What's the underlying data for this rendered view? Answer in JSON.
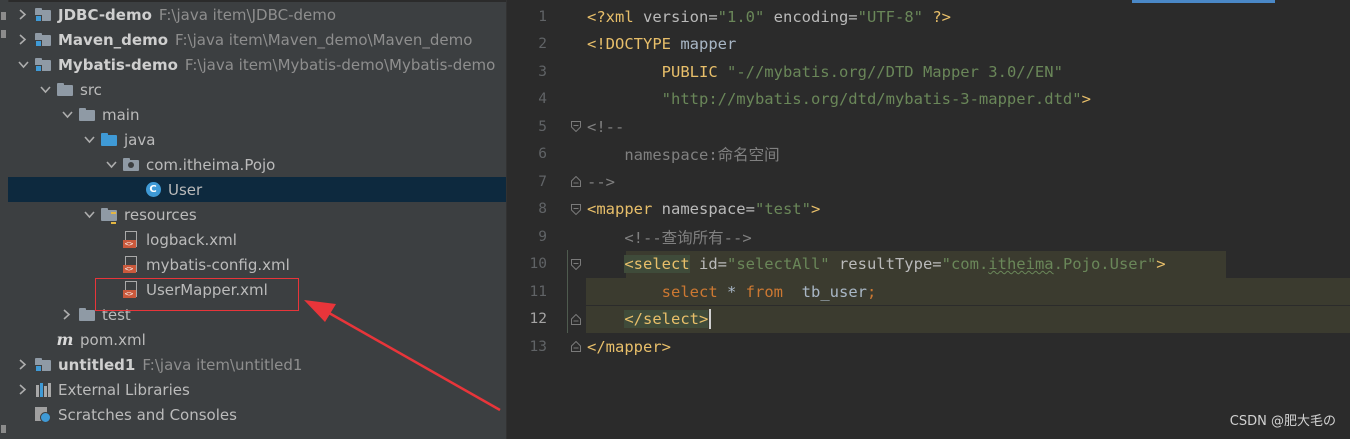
{
  "tree": {
    "items": [
      {
        "label": "JDBC-demo",
        "path": "F:\\java item\\JDBC-demo",
        "icon": "module-folder-icon",
        "arrow": "right",
        "depth": 0,
        "bold": true
      },
      {
        "label": "Maven_demo",
        "path": "F:\\java item\\Maven_demo\\Maven_demo",
        "icon": "module-folder-icon",
        "arrow": "right",
        "depth": 0,
        "bold": true
      },
      {
        "label": "Mybatis-demo",
        "path": "F:\\java item\\Mybatis-demo\\Mybatis-demo",
        "icon": "module-folder-icon",
        "arrow": "down",
        "depth": 0,
        "bold": true
      },
      {
        "label": "src",
        "icon": "folder-icon",
        "arrow": "down",
        "depth": 1
      },
      {
        "label": "main",
        "icon": "folder-icon",
        "arrow": "down",
        "depth": 2
      },
      {
        "label": "java",
        "icon": "source-folder-icon",
        "arrow": "down",
        "depth": 3
      },
      {
        "label": "com.itheima.Pojo",
        "icon": "package-icon",
        "arrow": "down",
        "depth": 4
      },
      {
        "label": "User",
        "icon": "java-class-icon",
        "arrow": "none",
        "depth": 5,
        "selected": true
      },
      {
        "label": "resources",
        "icon": "resources-folder-icon",
        "arrow": "down",
        "depth": 3
      },
      {
        "label": "logback.xml",
        "icon": "xml-file-icon",
        "arrow": "none",
        "depth": 4
      },
      {
        "label": "mybatis-config.xml",
        "icon": "xml-file-icon",
        "arrow": "none",
        "depth": 4
      },
      {
        "label": "UserMapper.xml",
        "icon": "xml-file-icon",
        "arrow": "none",
        "depth": 4
      },
      {
        "label": "test",
        "icon": "folder-icon",
        "arrow": "right",
        "depth": 2
      },
      {
        "label": "pom.xml",
        "icon": "maven-icon",
        "arrow": "none",
        "depth": 1
      },
      {
        "label": "untitled1",
        "path": "F:\\java item\\untitled1",
        "icon": "module-folder-icon",
        "arrow": "right",
        "depth": 0,
        "bold": true
      },
      {
        "label": "External Libraries",
        "icon": "libraries-icon",
        "arrow": "right",
        "depth": 0
      },
      {
        "label": "Scratches and Consoles",
        "icon": "scratches-icon",
        "arrow": "none",
        "depth": 0
      }
    ]
  },
  "editor": {
    "current_line": 12,
    "lines": [
      {
        "n": "1",
        "tokens": [
          [
            "pi",
            "<?xml "
          ],
          [
            "attr",
            "version="
          ],
          [
            "val",
            "\"1.0\" "
          ],
          [
            "attr",
            "encoding="
          ],
          [
            "val",
            "\"UTF-8\" "
          ],
          [
            "pi",
            "?>"
          ]
        ]
      },
      {
        "n": "2",
        "tokens": [
          [
            "tag",
            "<!DOCTYPE "
          ],
          [
            "plain",
            "mapper"
          ]
        ]
      },
      {
        "n": "3",
        "tokens": [
          [
            "plain",
            "        "
          ],
          [
            "tag",
            "PUBLIC "
          ],
          [
            "val",
            "\"-//mybatis.org//DTD Mapper 3.0//EN\""
          ]
        ]
      },
      {
        "n": "4",
        "tokens": [
          [
            "plain",
            "        "
          ],
          [
            "val",
            "\"http://mybatis.org/dtd/mybatis-3-mapper.dtd\""
          ],
          [
            "tag",
            ">"
          ]
        ]
      },
      {
        "n": "5",
        "tokens": [
          [
            "cmt",
            "<!--"
          ]
        ]
      },
      {
        "n": "6",
        "tokens": [
          [
            "cmt",
            "    namespace:命名空间"
          ]
        ]
      },
      {
        "n": "7",
        "tokens": [
          [
            "cmt",
            "-->"
          ]
        ]
      },
      {
        "n": "8",
        "tokens": [
          [
            "tag",
            "<mapper "
          ],
          [
            "attr",
            "namespace="
          ],
          [
            "val",
            "\"test\""
          ],
          [
            "tag",
            ">"
          ]
        ]
      },
      {
        "n": "9",
        "tokens": [
          [
            "cmt",
            "    <!--查询所有-->"
          ]
        ]
      },
      {
        "n": "10",
        "tokens": [
          [
            "plain",
            "    "
          ],
          [
            "tagm",
            "<select"
          ],
          [
            "attr",
            " id="
          ],
          [
            "val",
            "\"selectAll\" "
          ],
          [
            "attr",
            "resultType="
          ],
          [
            "val",
            "\"com."
          ],
          [
            "valsq",
            "itheima"
          ],
          [
            "val",
            ".Pojo.User\""
          ],
          [
            "tag",
            ">"
          ]
        ]
      },
      {
        "n": "11",
        "tokens": [
          [
            "plain",
            "        "
          ],
          [
            "kw",
            "select "
          ],
          [
            "plain",
            "* "
          ],
          [
            "kw",
            "from  "
          ],
          [
            "plain",
            "tb_user"
          ],
          [
            "kw",
            ";"
          ]
        ]
      },
      {
        "n": "12",
        "tokens": [
          [
            "plain",
            "    "
          ],
          [
            "tagm",
            "</select>"
          ]
        ]
      },
      {
        "n": "13",
        "tokens": [
          [
            "tag",
            "</mapper>"
          ]
        ]
      }
    ]
  },
  "watermark": "CSDN @肥大毛の"
}
